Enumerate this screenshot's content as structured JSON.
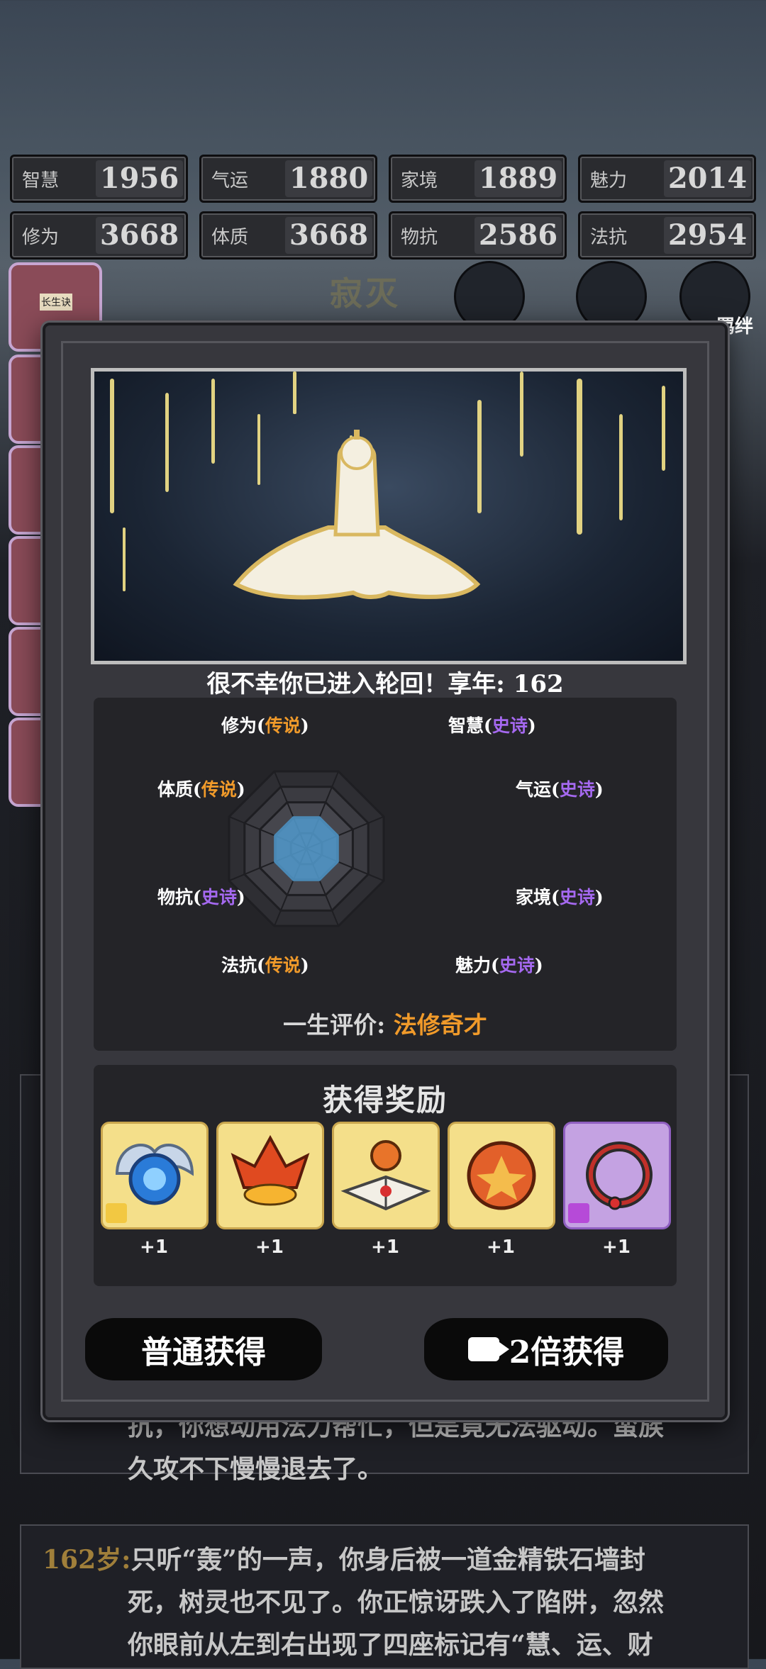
{
  "stats": [
    {
      "label": "智慧",
      "value": "1956"
    },
    {
      "label": "气运",
      "value": "1880"
    },
    {
      "label": "家境",
      "value": "1889"
    },
    {
      "label": "魅力",
      "value": "2014"
    },
    {
      "label": "修为",
      "value": "3668"
    },
    {
      "label": "体质",
      "value": "3668"
    },
    {
      "label": "物抗",
      "value": "2586"
    },
    {
      "label": "法抗",
      "value": "2954"
    }
  ],
  "background": {
    "realm_title": "寂灭",
    "bond_label": "羁绊",
    "book_label": "长生诀",
    "log_line_1": "抗，你想动用法力帮忙，但是竟无法驱动。蛮族",
    "log_line_2": "久攻不下慢慢退去了。",
    "log_age": "162岁:",
    "log_line_3": "只听“轰”的一声，你身后被一道金精铁石墙封",
    "log_line_4": "死，树灵也不见了。你正惊讶跌入了陷阱，忽然",
    "log_line_5": "你眼前从左到右出现了四座标记有“慧、运、财"
  },
  "modal": {
    "death_message": "很不幸你已进入轮回！享年: 162",
    "radar": {
      "axes": [
        {
          "name": "修为",
          "rank": "传说"
        },
        {
          "name": "智慧",
          "rank": "史诗"
        },
        {
          "name": "气运",
          "rank": "史诗"
        },
        {
          "name": "家境",
          "rank": "史诗"
        },
        {
          "name": "魅力",
          "rank": "史诗"
        },
        {
          "name": "法抗",
          "rank": "传说"
        },
        {
          "name": "物抗",
          "rank": "史诗"
        },
        {
          "name": "体质",
          "rank": "传说"
        }
      ],
      "level_fraction": 0.42
    },
    "eval_key": "一生评价:",
    "eval_value": "法修奇才",
    "reward_title": "获得奖励",
    "rewards": [
      {
        "icon": "blue-orb-icon",
        "count": "+1"
      },
      {
        "icon": "flame-flower-icon",
        "count": "+1"
      },
      {
        "icon": "open-book-icon",
        "count": "+1"
      },
      {
        "icon": "fire-pearl-icon",
        "count": "+1"
      },
      {
        "icon": "dragon-ring-icon",
        "count": "+1"
      }
    ],
    "btn_normal": "普通获得",
    "btn_double": "2倍获得"
  },
  "colors": {
    "legend": "#f09a2a",
    "epic": "#a569f0",
    "radar_fill": "#4f94c4"
  }
}
